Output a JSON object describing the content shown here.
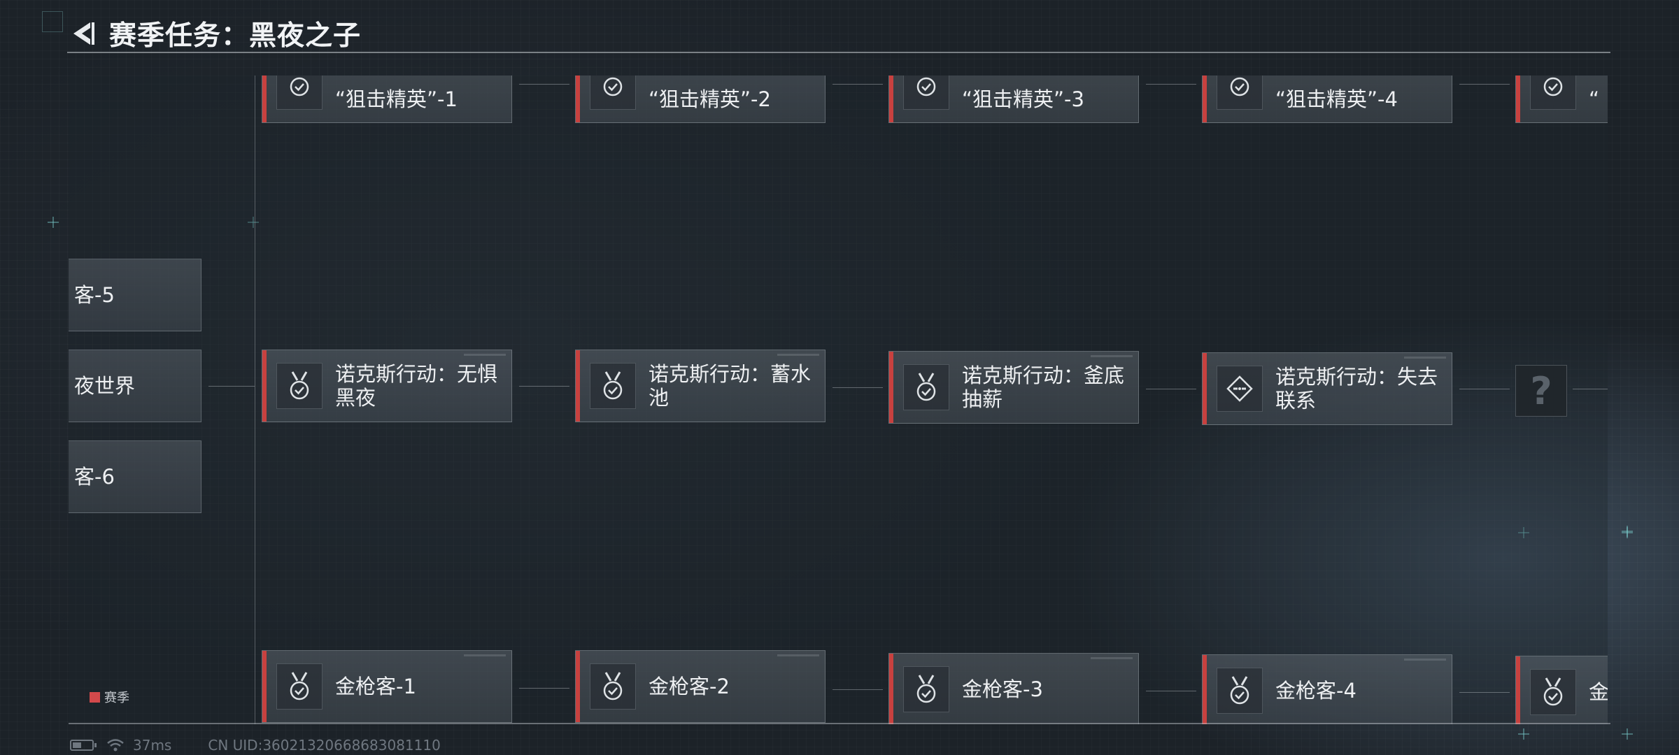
{
  "header": {
    "title": "赛季任务：黑夜之子",
    "back_icon": "back-arrow-icon"
  },
  "board": {
    "top_row": [
      {
        "label": "“狙击精英”-1",
        "icon": "check-badge-icon"
      },
      {
        "label": "“狙击精英”-2",
        "icon": "check-badge-icon"
      },
      {
        "label": "“狙击精英”-3",
        "icon": "check-badge-icon"
      },
      {
        "label": "“狙击精英”-4",
        "icon": "check-badge-icon"
      },
      {
        "label": "“",
        "icon": "check-badge-icon"
      }
    ],
    "middle_row": [
      {
        "label": "诺克斯行动：无惧黑夜",
        "icon": "medal-check-icon"
      },
      {
        "label": "诺克斯行动：蓄水池",
        "icon": "medal-check-icon"
      },
      {
        "label": "诺克斯行动：釜底抽薪",
        "icon": "medal-check-icon"
      },
      {
        "label": "诺克斯行动：失去联系",
        "icon": "diamond-target-icon"
      }
    ],
    "bottom_row": [
      {
        "label": "金枪客-1",
        "icon": "medal-check-icon"
      },
      {
        "label": "金枪客-2",
        "icon": "medal-check-icon"
      },
      {
        "label": "金枪客-3",
        "icon": "medal-check-icon"
      },
      {
        "label": "金枪客-4",
        "icon": "medal-check-icon"
      },
      {
        "label": "金",
        "icon": "medal-check-icon"
      }
    ],
    "left_column": [
      {
        "label": "客-5"
      },
      {
        "label": "夜世界"
      },
      {
        "label": "客-6"
      }
    ],
    "locked_symbol": "?"
  },
  "legend": {
    "label": "赛季",
    "color": "#d3494b"
  },
  "status": {
    "ping": "37ms",
    "uid": "CN UID:36021320668683081110"
  },
  "colors": {
    "accent_red": "#c8413f",
    "background": "#1b2127",
    "card": "#5c646c"
  }
}
